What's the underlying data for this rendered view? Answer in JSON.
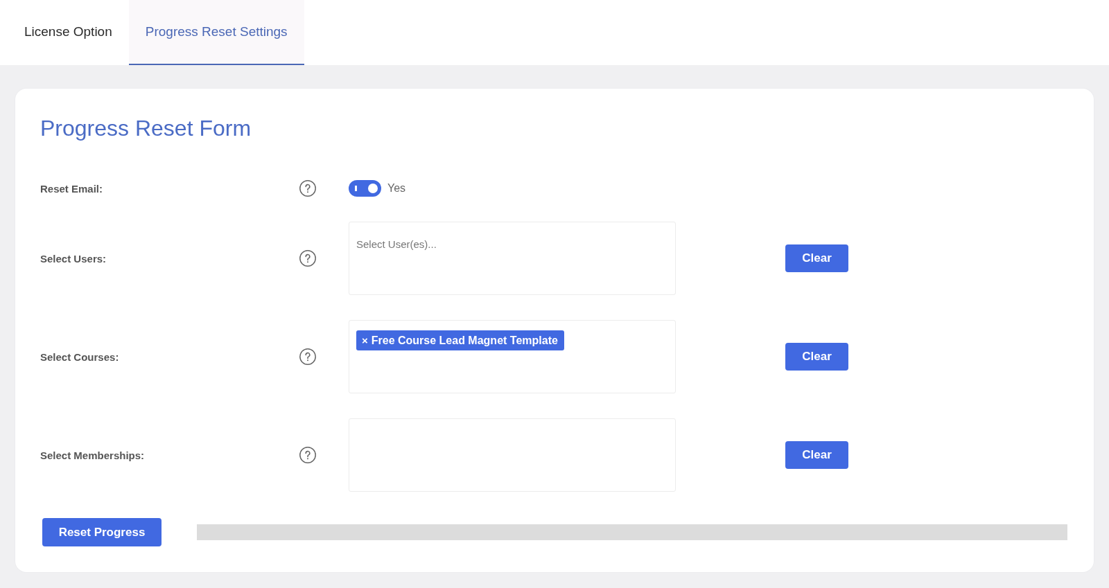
{
  "tabs": [
    {
      "label": "License Option",
      "selected": false
    },
    {
      "label": "Progress Reset Settings",
      "selected": true
    }
  ],
  "form": {
    "title": "Progress Reset Form",
    "fields": [
      {
        "kind": "toggle",
        "label": "Reset Email:",
        "on": true,
        "value_label": "Yes"
      },
      {
        "kind": "multiselect",
        "label": "Select Users:",
        "placeholder": "Select User(es)...",
        "clear_button": "Clear"
      },
      {
        "kind": "multiselect",
        "label": "Select Courses:",
        "tags": [
          {
            "label": "Free Course Lead Magnet Template",
            "remove": "×"
          }
        ],
        "clear_button": "Clear"
      },
      {
        "kind": "multiselect",
        "label": "Select Memberships:",
        "clear_button": "Clear"
      }
    ],
    "submit_button": "Reset Progress"
  }
}
